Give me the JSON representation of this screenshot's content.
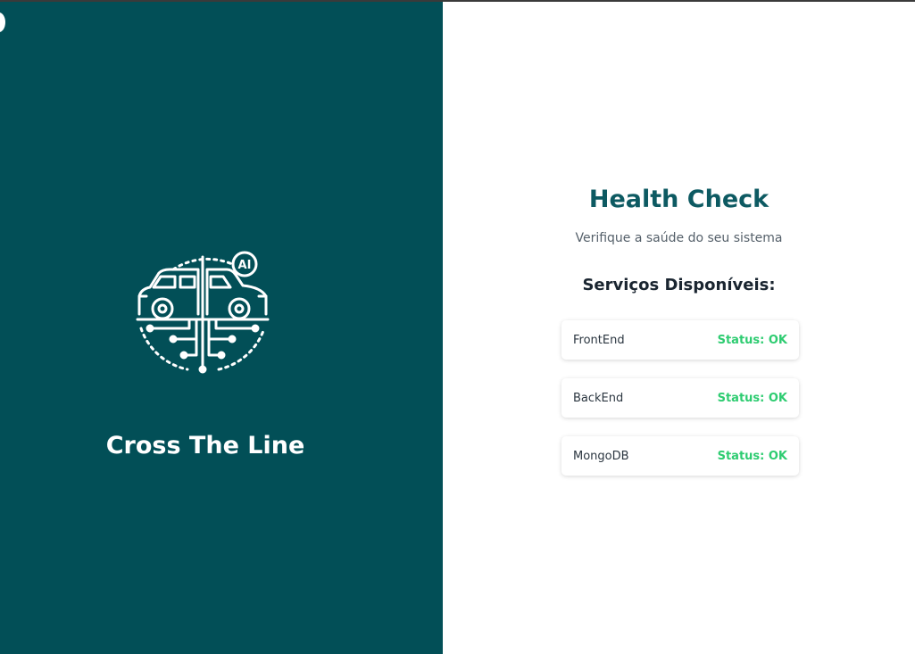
{
  "brand": {
    "name": "Cross The Line",
    "logo_icon": "car-ai-circuit-icon"
  },
  "health": {
    "title": "Health Check",
    "subtitle": "Verifique a saúde do seu sistema",
    "section_title": "Serviços Disponíveis:",
    "services": [
      {
        "name": "FrontEnd",
        "status": "Status: OK"
      },
      {
        "name": "BackEnd",
        "status": "Status: OK"
      },
      {
        "name": "MongoDB",
        "status": "Status: OK"
      }
    ]
  },
  "colors": {
    "panel_bg": "#024f57",
    "title": "#0d5a62",
    "status_ok": "#2ecc71"
  }
}
